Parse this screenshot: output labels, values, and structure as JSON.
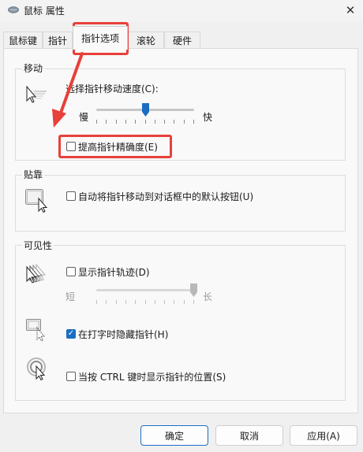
{
  "window": {
    "title": "鼠标 属性",
    "close_symbol": "✕"
  },
  "tabs": [
    {
      "label": "鼠标键"
    },
    {
      "label": "指针"
    },
    {
      "label": "指针选项",
      "active": true
    },
    {
      "label": "滚轮"
    },
    {
      "label": "硬件"
    }
  ],
  "motion": {
    "title": "移动",
    "speed_label": "选择指针移动速度(C):",
    "slow_label": "慢",
    "fast_label": "快",
    "speed_level_fraction": 0.5,
    "precision_label": "提高指针精确度(E)",
    "precision_checked": false
  },
  "snap": {
    "title": "贴靠",
    "snap_label": "自动将指针移动到对话框中的默认按钮(U)",
    "snap_checked": false
  },
  "visibility": {
    "title": "可见性",
    "trails_label": "显示指针轨迹(D)",
    "trails_checked": false,
    "short_label": "短",
    "long_label": "长",
    "trail_level_fraction": 1.0,
    "hide_label": "在打字时隐藏指针(H)",
    "hide_checked": true,
    "ctrl_label": "当按 CTRL 键时显示指针的位置(S)",
    "ctrl_checked": false
  },
  "buttons": {
    "ok": "确定",
    "cancel": "取消",
    "apply": "应用(A)"
  },
  "colors": {
    "accent": "#1b6ec2",
    "annotation": "#e8403a"
  },
  "icons": {
    "app": "mouse-icon",
    "motion": "pointer-speed-icon",
    "snap": "snap-pointer-icon",
    "trails": "pointer-trails-icon",
    "hide": "hide-pointer-icon",
    "ctrl": "pointer-location-icon"
  }
}
